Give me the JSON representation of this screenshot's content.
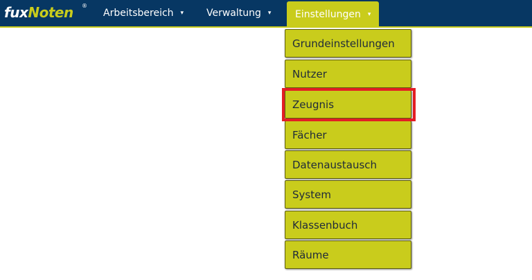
{
  "brand": {
    "part1": "fux",
    "part2": "Noten",
    "registered": "®"
  },
  "nav": {
    "items": [
      {
        "label": "Arbeitsbereich",
        "caret": "▾"
      },
      {
        "label": "Verwaltung",
        "caret": "▾"
      },
      {
        "label": "Einstellungen",
        "caret": "▾",
        "active": true
      }
    ]
  },
  "dropdown": {
    "items": [
      {
        "label": "Grundeinstellungen"
      },
      {
        "label": "Nutzer"
      },
      {
        "label": "Zeugnis",
        "highlighted": true
      },
      {
        "label": "Fächer"
      },
      {
        "label": "Datenaustausch"
      },
      {
        "label": "System"
      },
      {
        "label": "Klassenbuch"
      },
      {
        "label": "Räume"
      }
    ]
  },
  "colors": {
    "navbar_bg": "#073763",
    "accent": "#c9cc1c",
    "highlight_border": "#e31e24"
  }
}
